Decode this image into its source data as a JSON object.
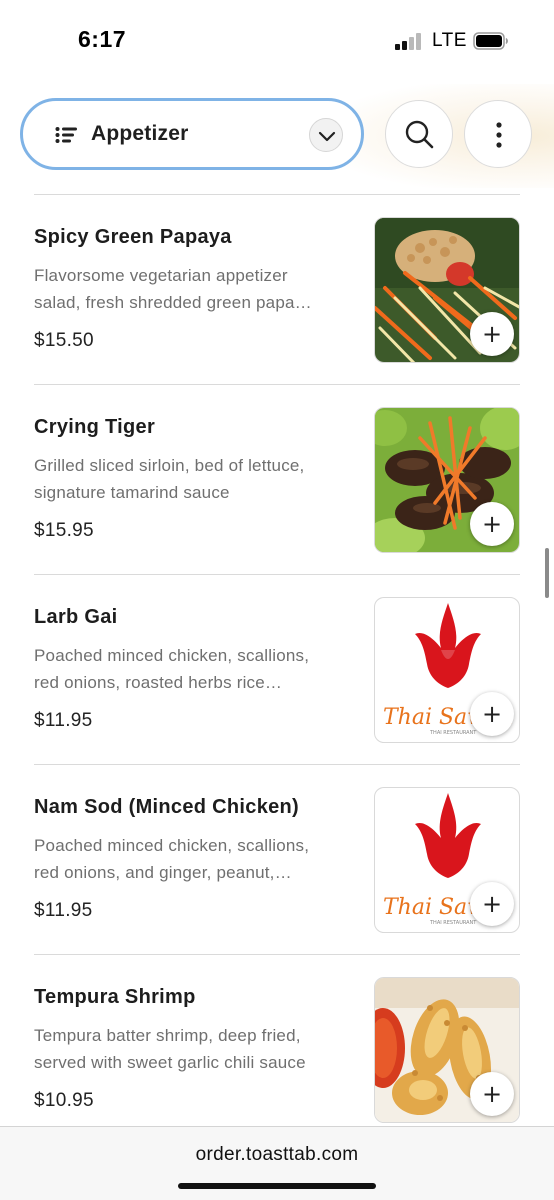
{
  "status_bar": {
    "time": "6:17",
    "network": "LTE"
  },
  "header": {
    "category_selected": "Appetizer",
    "list_icon": "list-icon",
    "dropdown_icon": "chevron-down-icon",
    "search_icon": "search-icon",
    "more_icon": "more-vertical-icon"
  },
  "menu_items": [
    {
      "name": "Spicy Green Papaya",
      "desc_line1": "Flavorsome vegetarian appetizer",
      "desc_line2": "salad, fresh shredded green papa…",
      "price": "$15.50",
      "image": "papaya-salad-photo"
    },
    {
      "name": "Crying Tiger",
      "desc_line1": "Grilled sliced sirloin, bed of lettuce,",
      "desc_line2": "signature tamarind sauce",
      "price": "$15.95",
      "image": "grilled-sirloin-photo"
    },
    {
      "name": "Larb Gai",
      "desc_line1": "Poached minced chicken, scallions,",
      "desc_line2": "red onions, roasted herbs rice…",
      "price": "$11.95",
      "image": "thai-sawan-logo",
      "logo_text": "Thai Sawan",
      "logo_subtext": "THAI RESTAURANT"
    },
    {
      "name": "Nam Sod (Minced Chicken)",
      "desc_line1": "Poached minced chicken, scallions,",
      "desc_line2": "red onions, and ginger, peanut,…",
      "price": "$11.95",
      "image": "thai-sawan-logo",
      "logo_text": "Thai Sawan",
      "logo_subtext": "THAI RESTAURANT"
    },
    {
      "name": "Tempura Shrimp",
      "desc_line1": "Tempura batter shrimp, deep fried,",
      "desc_line2": "served with sweet garlic chili sauce",
      "price": "$10.95",
      "image": "tempura-shrimp-photo"
    }
  ],
  "add_button_label": "+",
  "url_bar": {
    "url": "order.toasttab.com"
  },
  "colors": {
    "select_border": "#7fb3e6",
    "logo_red": "#d9151c",
    "logo_orange": "#e8731c"
  }
}
